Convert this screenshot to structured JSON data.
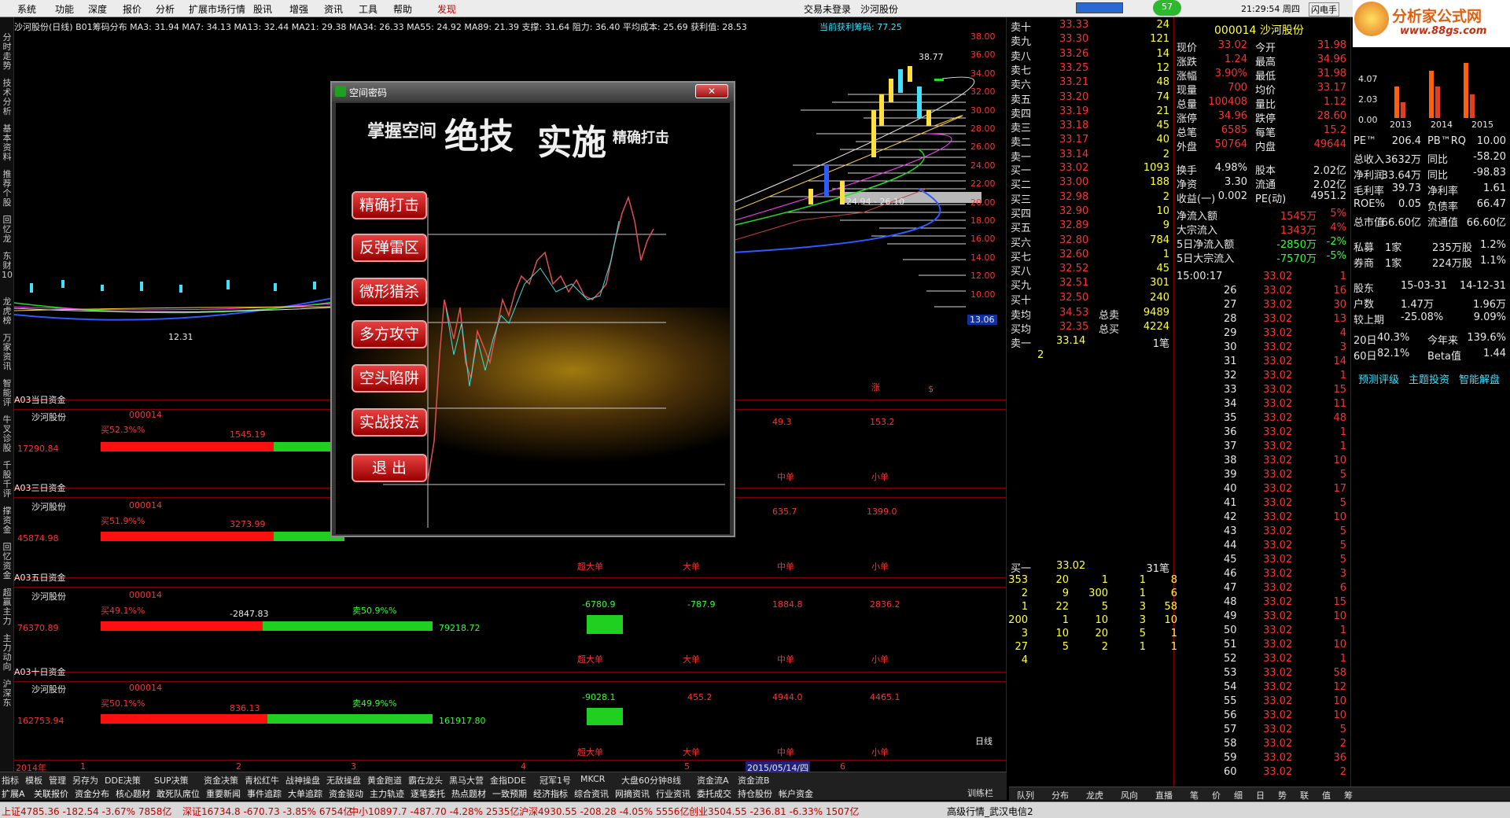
{
  "menu": [
    "系统",
    "功能",
    "深度",
    "报价",
    "分析",
    "扩展市场行情",
    "股讯",
    "增强",
    "资讯",
    "工具",
    "帮助",
    "发现"
  ],
  "top_right": {
    "trade": "交易未登录",
    "stock": "沙河股份",
    "badge": "57",
    "time": "21:29:54 周四",
    "flash": "闪电手",
    "logo": "分析家公式网",
    "logo_url": "www.88gs.com"
  },
  "chart_header": "沙河股份(日线) B01筹码分布 MA3: 31.94 MA7: 34.13 MA13: 32.44 MA21: 29.38 MA34: 26.33 MA55: 24.92 MA89: 21.39 支撑: 31.64 阻力: 36.40 平均成本: 25.69 获利值: 28.53",
  "chip_label": "当前获利筹码: 77.25",
  "price_scale": [
    "38.00",
    "36.00",
    "34.00",
    "32.00",
    "30.00",
    "28.00",
    "26.00",
    "24.00",
    "22.00",
    "20.00",
    "18.00",
    "16.00",
    "14.00",
    "12.00",
    "10.00"
  ],
  "price_current": "13.06",
  "chart_labels": {
    "high": "38.77",
    "low": "12.31",
    "p1": "24.94 - 26.10",
    "mark_zhang": "涨",
    "mark_dollar": "$",
    "day": "日线"
  },
  "left_tabs": [
    "分时走势",
    "技术分析",
    "基本资料",
    "推荐个股",
    "回忆龙",
    "东财10",
    "龙虎榜",
    "万家资讯",
    "智能评",
    "牛叉诊股",
    "千股千评",
    "撑资金",
    "回忆资金",
    "超赢主力",
    "主力动向",
    "沪深东"
  ],
  "fund_panels": [
    {
      "title": "A03当日资金",
      "name": "沙河股份",
      "code": "000014",
      "buy": "买52.3%%",
      "val1": "1545.19",
      "left": "17290.84",
      "right": "",
      "sell": "",
      "nums": [
        "49.3",
        "153.2"
      ],
      "labels": [
        "中单",
        "小单"
      ]
    },
    {
      "title": "A03三日资金",
      "name": "沙河股份",
      "code": "000014",
      "buy": "买51.9%%",
      "val1": "3273.99",
      "left": "45874.98",
      "right": "",
      "sell": "",
      "nums": [
        "635.7",
        "1399.0"
      ],
      "labels": [
        "超大单",
        "大单",
        "中单",
        "小单"
      ]
    },
    {
      "title": "A03五日资金",
      "name": "沙河股份",
      "code": "000014",
      "buy": "买49.1%%",
      "val1": "-2847.83",
      "left": "76370.89",
      "right": "79218.72",
      "sell": "卖50.9%%",
      "nums": [
        "-6780.9",
        "-787.9",
        "1884.8",
        "2836.2"
      ],
      "labels": [
        "超大单",
        "大单",
        "中单",
        "小单"
      ]
    },
    {
      "title": "A03十日资金",
      "name": "沙河股份",
      "code": "000014",
      "buy": "买50.1%%",
      "val1": "836.13",
      "left": "162753.94",
      "right": "161917.80",
      "sell": "卖49.9%%",
      "nums": [
        "-9028.1",
        "455.2",
        "4944.0",
        "4465.1"
      ],
      "labels": [
        "超大单",
        "大单",
        "中单",
        "小单"
      ]
    }
  ],
  "x_axis": {
    "year": "2014年",
    "m1": "1",
    "m2": "2",
    "m3": "3",
    "m4": "4",
    "m5": "5",
    "date": "2015/05/14/四",
    "m6": "6"
  },
  "dialog": {
    "title": "空间密码",
    "banner_small1": "掌握空间",
    "banner_big1": "绝技",
    "banner_big2": "实施",
    "banner_small2": "精确打击",
    "buttons": [
      "精确打击",
      "反弹雷区",
      "微形猎杀",
      "多方攻守",
      "空头陷阱",
      "实战技法",
      "退 出"
    ]
  },
  "orderbook": {
    "sells": [
      [
        "卖十",
        "33.33",
        "24"
      ],
      [
        "卖九",
        "33.30",
        "121"
      ],
      [
        "卖八",
        "33.26",
        "14"
      ],
      [
        "卖七",
        "33.25",
        "12"
      ],
      [
        "卖六",
        "33.21",
        "48"
      ],
      [
        "卖五",
        "33.20",
        "74"
      ],
      [
        "卖四",
        "33.19",
        "21"
      ],
      [
        "卖三",
        "33.18",
        "45"
      ],
      [
        "卖二",
        "33.17",
        "40"
      ],
      [
        "卖一",
        "33.14",
        "2"
      ]
    ],
    "buys": [
      [
        "买一",
        "33.02",
        "1093"
      ],
      [
        "买二",
        "33.00",
        "188"
      ],
      [
        "买三",
        "32.98",
        "2"
      ],
      [
        "买四",
        "32.90",
        "10"
      ],
      [
        "买五",
        "32.89",
        "9"
      ],
      [
        "买六",
        "32.80",
        "784"
      ],
      [
        "买七",
        "32.60",
        "1"
      ],
      [
        "买八",
        "32.52",
        "45"
      ],
      [
        "买九",
        "32.51",
        "301"
      ],
      [
        "买十",
        "32.50",
        "240"
      ]
    ],
    "avg_sell": [
      "卖均",
      "34.53",
      "总卖",
      "9489"
    ],
    "avg_buy": [
      "买均",
      "32.35",
      "总买",
      "4224"
    ],
    "sell1": [
      "卖一",
      "33.14",
      "1笔"
    ],
    "sell1_sub": "2",
    "buy1": [
      "买一",
      "33.02",
      "31笔"
    ],
    "queue": [
      [
        "353",
        "20",
        "1",
        "1",
        "8"
      ],
      [
        "2",
        "9",
        "300",
        "1",
        "6"
      ],
      [
        "1",
        "22",
        "5",
        "3",
        "58"
      ],
      [
        "200",
        "1",
        "10",
        "3",
        "10"
      ],
      [
        "3",
        "10",
        "20",
        "5",
        "1"
      ],
      [
        "27",
        "5",
        "2",
        "1",
        "1"
      ],
      [
        "4",
        "",
        "",
        "",
        ""
      ]
    ]
  },
  "stock_info": {
    "title": "000014 沙河股份",
    "rows": [
      [
        "现价",
        "33.02",
        "今开",
        "31.98"
      ],
      [
        "涨跌",
        "1.24",
        "最高",
        "34.96"
      ],
      [
        "涨幅",
        "3.90%",
        "最低",
        "31.98"
      ],
      [
        "现量",
        "700",
        "均价",
        "33.17"
      ],
      [
        "总量",
        "100408",
        "量比",
        "1.12"
      ],
      [
        "涨停",
        "34.96",
        "跌停",
        "28.60"
      ],
      [
        "总笔",
        "6585",
        "每笔",
        "15.2"
      ],
      [
        "外盘",
        "50764",
        "内盘",
        "49644"
      ]
    ],
    "rows2": [
      [
        "换手",
        "4.98%",
        "股本",
        "2.02亿"
      ],
      [
        "净资",
        "3.30",
        "流通",
        "2.02亿"
      ],
      [
        "收益(一)",
        "0.002",
        "PE(动)",
        "4951.2"
      ]
    ],
    "flows": [
      [
        "净流入额",
        "1545万",
        "5%"
      ],
      [
        "大宗流入",
        "1343万",
        "4%"
      ],
      [
        "5日净流入额",
        "-2850万",
        "-2%"
      ],
      [
        "5日大宗流入",
        "-7570万",
        "-5%"
      ]
    ],
    "tick_time": "15:00:17",
    "ticks": [
      [
        "26",
        "33.02",
        "16"
      ],
      [
        "27",
        "33.02",
        "30"
      ],
      [
        "28",
        "33.02",
        "13"
      ],
      [
        "29",
        "33.02",
        "4"
      ],
      [
        "30",
        "33.02",
        "3"
      ],
      [
        "31",
        "33.02",
        "14"
      ],
      [
        "32",
        "33.02",
        "1"
      ],
      [
        "33",
        "33.02",
        "15"
      ],
      [
        "34",
        "33.02",
        "11"
      ],
      [
        "35",
        "33.02",
        "48"
      ],
      [
        "36",
        "33.02",
        "1"
      ],
      [
        "37",
        "33.02",
        "1"
      ],
      [
        "38",
        "33.02",
        "10"
      ],
      [
        "39",
        "33.02",
        "5"
      ],
      [
        "40",
        "33.02",
        "17"
      ],
      [
        "41",
        "33.02",
        "5"
      ],
      [
        "42",
        "33.02",
        "10"
      ],
      [
        "43",
        "33.02",
        "5"
      ],
      [
        "44",
        "33.02",
        "5"
      ],
      [
        "45",
        "33.02",
        "5"
      ],
      [
        "46",
        "33.02",
        "3"
      ],
      [
        "47",
        "33.02",
        "6"
      ],
      [
        "48",
        "33.02",
        "15"
      ],
      [
        "49",
        "33.02",
        "10"
      ],
      [
        "50",
        "33.02",
        "1"
      ],
      [
        "51",
        "33.02",
        "10"
      ],
      [
        "52",
        "33.02",
        "1"
      ],
      [
        "53",
        "33.02",
        "58"
      ],
      [
        "54",
        "33.02",
        "12"
      ],
      [
        "55",
        "33.02",
        "10"
      ],
      [
        "56",
        "33.02",
        "10"
      ],
      [
        "57",
        "33.02",
        "5"
      ],
      [
        "58",
        "33.02",
        "2"
      ],
      [
        "59",
        "33.02",
        "36"
      ],
      [
        "60",
        "33.02",
        "2"
      ]
    ],
    "tick_first": "1"
  },
  "fin_info": {
    "chart_years": [
      "2013",
      "2014",
      "2015"
    ],
    "chart_vals": [
      "4.07",
      "2.03",
      "0.00"
    ],
    "rows": [
      [
        "PE™",
        "206.4",
        "PB™RQ",
        "10.00"
      ],
      [
        "总收入",
        "3632万",
        "同比",
        "-58.20"
      ],
      [
        "净利润",
        "33.64万",
        "同比",
        "-98.83"
      ],
      [
        "毛利率",
        "39.73",
        "净利率",
        "1.61"
      ],
      [
        "ROE%",
        "0.05",
        "负债率",
        "66.47"
      ],
      [
        "总市值",
        "66.60亿",
        "流通值",
        "66.60亿"
      ]
    ],
    "rows2": [
      [
        "私募",
        "1家",
        "235万股",
        "1.2%"
      ],
      [
        "券商",
        "1家",
        "224万股",
        "1.1%"
      ]
    ],
    "rows3": [
      [
        "股东",
        "15-03-31",
        "14-12-31"
      ],
      [
        "户数",
        "1.47万",
        "1.96万"
      ],
      [
        "较上期",
        "-25.08%",
        "9.09%"
      ]
    ],
    "rows4": [
      [
        "20日",
        "40.3%",
        "今年来",
        "139.6%"
      ],
      [
        "60日",
        "82.1%",
        "Beta值",
        "1.44"
      ]
    ],
    "links": [
      "预测评级",
      "主题投资",
      "智能解盘"
    ]
  },
  "bottom_tabs1": [
    "指标",
    "模板",
    "管理",
    "另存为",
    "DDE决策",
    "SUP决策",
    "资金决策",
    "青松红牛",
    "战神操盘",
    "无敌操盘",
    "黄金跑道",
    "霸在龙头",
    "黑马大营",
    "金指DDE",
    "冠军1号",
    "MKCR",
    "大盘60分钟8线",
    "资金流A",
    "资金流B"
  ],
  "bottom_tabs2": [
    "扩展A",
    "关联报价",
    "资金分布",
    "核心题材",
    "敢死队席位",
    "重要新闻",
    "事件追踪",
    "大单追踪",
    "资金驱动",
    "主力轨迹",
    "逐笔委托",
    "热点题材",
    "一致预期",
    "经济指标",
    "综合资讯",
    "网摘资讯",
    "行业资讯",
    "委托成交",
    "持仓股份",
    "帐户资金"
  ],
  "right_tabs": [
    "队列",
    "分布",
    "龙虎",
    "风向",
    "直播",
    "笔",
    "价",
    "细",
    "日",
    "势",
    "联",
    "值",
    "筹"
  ],
  "corner_tab": "训练栏",
  "status": {
    "sh": "上证4785.36 -182.54 -3.67% 7858亿",
    "sz": "深证16734.8 -670.73 -3.85% 6754亿",
    "zx": "中小10897.7 -487.70 -4.28% 2535亿",
    "hs": "沪深4930.55 -208.28 -4.05% 5556亿",
    "cy": "创业3504.55 -236.81 -6.33% 1507亿",
    "hq": "高级行情_武汉电信2"
  }
}
